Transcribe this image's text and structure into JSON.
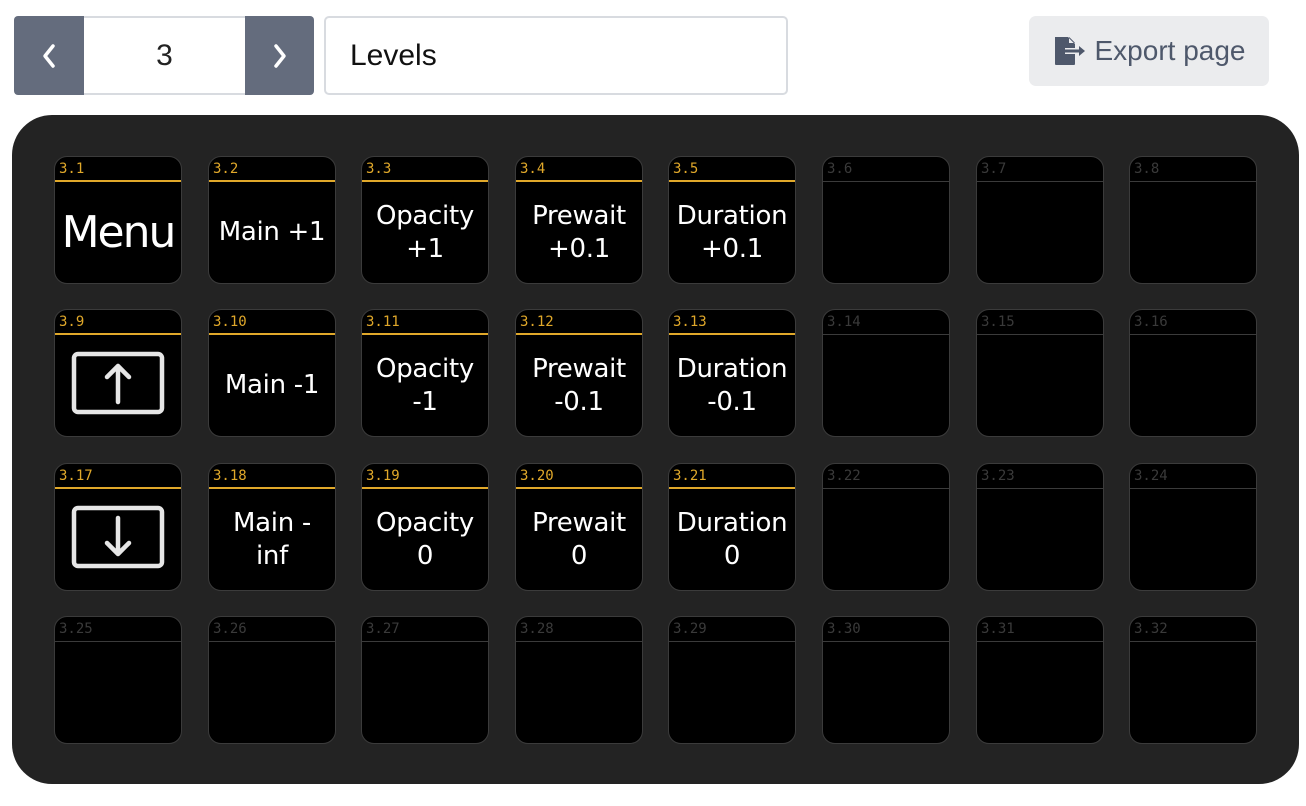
{
  "toolbar": {
    "prev_label": "previous page",
    "next_label": "next page",
    "page_number": "3",
    "page_name": "Levels",
    "export_label": "Export page"
  },
  "colors": {
    "accent": "#e0a82a",
    "panel_bg": "#232323",
    "button_bg": "#000000",
    "pager_btn": "#646c7d",
    "export_text": "#4e586b"
  },
  "grid": {
    "columns": 8,
    "rows": 4,
    "buttons": [
      {
        "index": "3.1",
        "label": "Menu",
        "active": true,
        "style": "big"
      },
      {
        "index": "3.2",
        "label": "Main  +1",
        "active": true
      },
      {
        "index": "3.3",
        "label": "Opacity\n+1",
        "active": true
      },
      {
        "index": "3.4",
        "label": "Prewait\n+0.1",
        "active": true
      },
      {
        "index": "3.5",
        "label": "Duration\n+0.1",
        "active": true
      },
      {
        "index": "3.6",
        "label": "",
        "active": false
      },
      {
        "index": "3.7",
        "label": "",
        "active": false
      },
      {
        "index": "3.8",
        "label": "",
        "active": false
      },
      {
        "index": "3.9",
        "label": "",
        "active": true,
        "icon": "arrow-up-icon"
      },
      {
        "index": "3.10",
        "label": "Main  -1",
        "active": true
      },
      {
        "index": "3.11",
        "label": "Opacity\n-1",
        "active": true
      },
      {
        "index": "3.12",
        "label": "Prewait\n-0.1",
        "active": true
      },
      {
        "index": "3.13",
        "label": "Duration\n-0.1",
        "active": true
      },
      {
        "index": "3.14",
        "label": "",
        "active": false
      },
      {
        "index": "3.15",
        "label": "",
        "active": false
      },
      {
        "index": "3.16",
        "label": "",
        "active": false
      },
      {
        "index": "3.17",
        "label": "",
        "active": true,
        "icon": "arrow-down-icon"
      },
      {
        "index": "3.18",
        "label": "Main  -\ninf",
        "active": true
      },
      {
        "index": "3.19",
        "label": "Opacity\n0",
        "active": true
      },
      {
        "index": "3.20",
        "label": "Prewait\n0",
        "active": true
      },
      {
        "index": "3.21",
        "label": "Duration\n0",
        "active": true
      },
      {
        "index": "3.22",
        "label": "",
        "active": false
      },
      {
        "index": "3.23",
        "label": "",
        "active": false
      },
      {
        "index": "3.24",
        "label": "",
        "active": false
      },
      {
        "index": "3.25",
        "label": "",
        "active": false
      },
      {
        "index": "3.26",
        "label": "",
        "active": false
      },
      {
        "index": "3.27",
        "label": "",
        "active": false
      },
      {
        "index": "3.28",
        "label": "",
        "active": false
      },
      {
        "index": "3.29",
        "label": "",
        "active": false
      },
      {
        "index": "3.30",
        "label": "",
        "active": false
      },
      {
        "index": "3.31",
        "label": "",
        "active": false
      },
      {
        "index": "3.32",
        "label": "",
        "active": false
      }
    ]
  }
}
